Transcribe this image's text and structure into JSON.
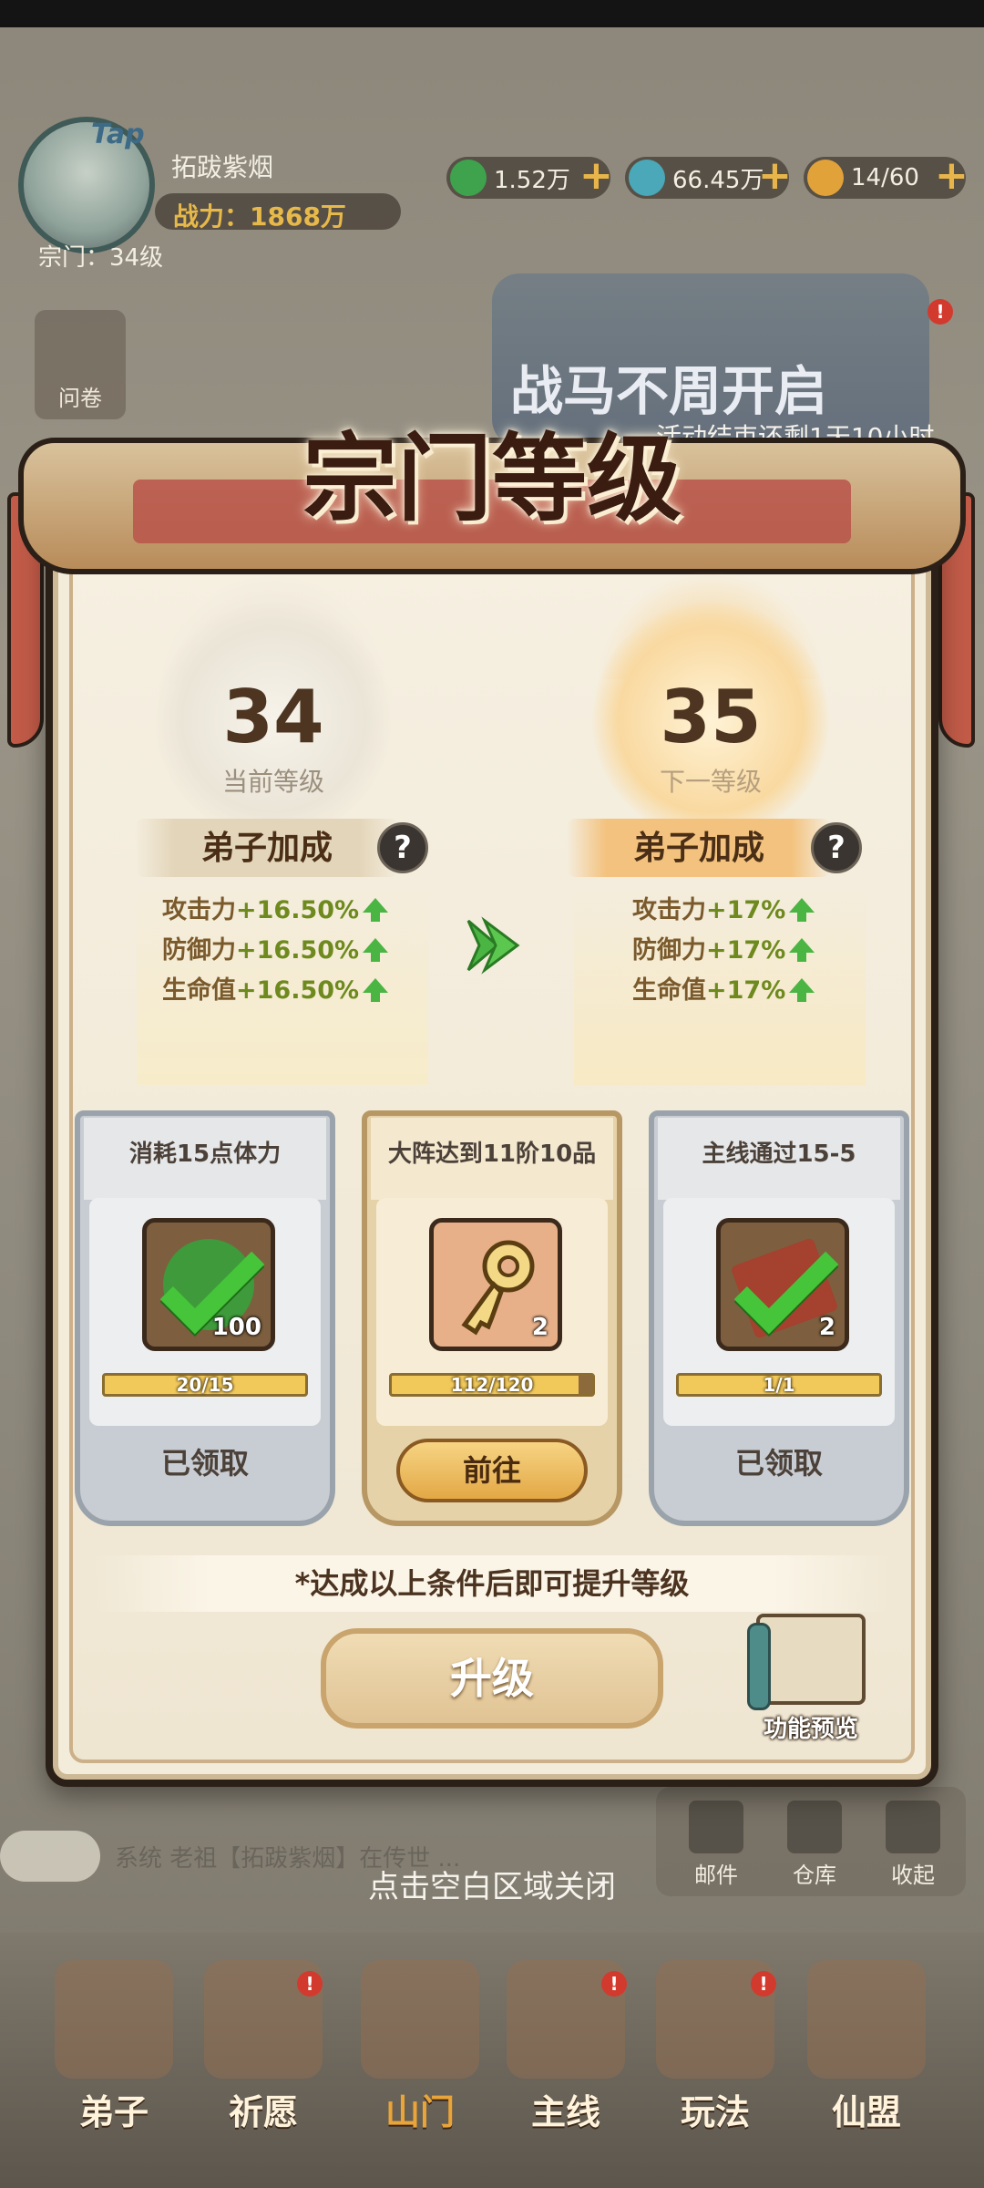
{
  "player": {
    "tap_label": "Tap",
    "name": "拓跋紫烟",
    "power": "战力：1868万",
    "sect_level": "宗门：34级"
  },
  "resources": [
    {
      "icon": "jade-coin-icon",
      "value": "1.52万",
      "color": "#3fa34d"
    },
    {
      "icon": "blue-gem-icon",
      "value": "66.45万",
      "color": "#4aa8b8"
    },
    {
      "icon": "stamina-flame-icon",
      "value": "14/60",
      "color": "#e2a23a"
    }
  ],
  "side": {
    "survey_label": "问卷"
  },
  "event": {
    "title": "战马不周开启",
    "countdown": "活动结束还剩1天10小时"
  },
  "dialog": {
    "title": "宗门等级",
    "current": {
      "level": "34",
      "caption": "当前等级"
    },
    "next": {
      "level": "35",
      "caption": "下一等级"
    },
    "bonus_label": "弟子加成",
    "current_stats": [
      {
        "name": "攻击力",
        "value": "+16.50%"
      },
      {
        "name": "防御力",
        "value": "+16.50%"
      },
      {
        "name": "生命值",
        "value": "+16.50%"
      }
    ],
    "next_stats": [
      {
        "name": "攻击力",
        "value": "+17%"
      },
      {
        "name": "防御力",
        "value": "+17%"
      },
      {
        "name": "生命值",
        "value": "+17%"
      }
    ],
    "tasks": [
      {
        "title": "消耗15点体力",
        "item_count": "100",
        "progress": "20/15",
        "fill": 1.0,
        "status": "已领取"
      },
      {
        "title": "大阵达到11阶10品",
        "item_count": "2",
        "progress": "112/120",
        "fill": 0.933,
        "button": "前往"
      },
      {
        "title": "主线通过15-5",
        "item_count": "2",
        "progress": "1/1",
        "fill": 1.0,
        "status": "已领取"
      }
    ],
    "hint": "*达成以上条件后即可提升等级",
    "upgrade_label": "升级",
    "preview_label": "功能预览"
  },
  "chat": {
    "text": "系统 老祖【拓跋紫烟】在传世 ..."
  },
  "corner_buttons": [
    "邮件",
    "仓库",
    "收起"
  ],
  "close_hint": "点击空白区域关闭",
  "nav": [
    {
      "label": "弟子",
      "active": false
    },
    {
      "label": "祈愿",
      "active": false
    },
    {
      "label": "山门",
      "active": true
    },
    {
      "label": "主线",
      "active": false
    },
    {
      "label": "玩法",
      "active": false
    },
    {
      "label": "仙盟",
      "active": false
    }
  ],
  "colors": {
    "accent_gold": "#e3a846",
    "stat_green": "#4bb543",
    "badge_red": "#d23a2e"
  }
}
